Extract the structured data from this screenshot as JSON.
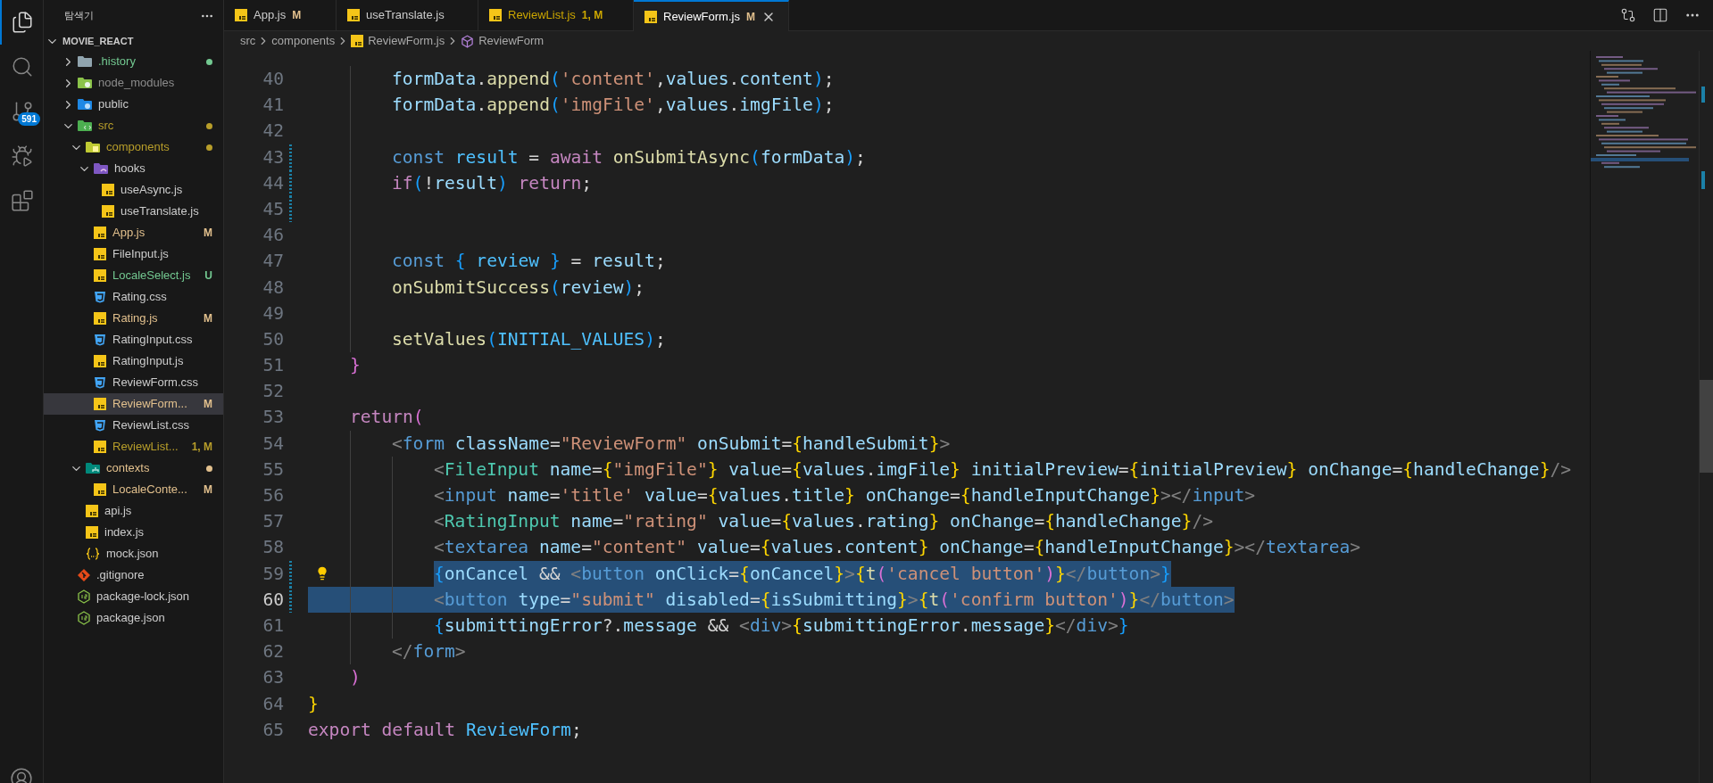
{
  "activity_bar": {
    "items": [
      {
        "kind": "explorer",
        "selected": true
      },
      {
        "kind": "search",
        "selected": false
      },
      {
        "kind": "source-control",
        "selected": false,
        "badge": "591"
      },
      {
        "kind": "run-debug",
        "selected": false
      },
      {
        "kind": "extensions",
        "selected": false
      }
    ]
  },
  "sidebar": {
    "title": "탐색기",
    "root": {
      "name": "MOVIE_REACT",
      "expanded": true,
      "items": [
        {
          "kind": "history-folder",
          "name": ".history",
          "color": "#73c991",
          "dot": true,
          "selected": false,
          "expanded": false
        },
        {
          "kind": "node-folder",
          "name": "node_modules",
          "color": "#8c8c8c",
          "dot": false,
          "selected": false,
          "expanded": false
        },
        {
          "kind": "public-folder",
          "name": "public",
          "color": "#cccccc",
          "dot": false,
          "selected": false,
          "expanded": false
        },
        {
          "kind": "src-folder",
          "name": "src",
          "color": "#b89e2a",
          "dot": true,
          "selected": false,
          "expanded": true,
          "children": [
            {
              "kind": "components-folder",
              "name": "components",
              "color": "#b89e2a",
              "dot": true,
              "selected": false,
              "expanded": true,
              "children": [
                {
                  "kind": "hooks-folder",
                  "name": "hooks",
                  "color": "#cccccc",
                  "dot": false,
                  "selected": false,
                  "expanded": true,
                  "children": [
                    {
                      "kind": "js-file",
                      "name": "useAsync.js",
                      "color": "#cccccc",
                      "dot": false,
                      "selected": false
                    },
                    {
                      "kind": "js-file",
                      "name": "useTranslate.js",
                      "color": "#cccccc",
                      "dot": false,
                      "selected": false
                    }
                  ]
                },
                {
                  "kind": "js-file",
                  "name": "App.js",
                  "color": "#e2c08d",
                  "badge": "M",
                  "dot": false,
                  "selected": false
                },
                {
                  "kind": "js-file",
                  "name": "FileInput.js",
                  "color": "#cccccc",
                  "dot": false,
                  "selected": false
                },
                {
                  "kind": "js-file",
                  "name": "LocaleSelect.js",
                  "color": "#73c991",
                  "badge": "U",
                  "dot": false,
                  "selected": false
                },
                {
                  "kind": "css-file",
                  "name": "Rating.css",
                  "color": "#cccccc",
                  "dot": false,
                  "selected": false
                },
                {
                  "kind": "js-file",
                  "name": "Rating.js",
                  "color": "#e2c08d",
                  "badge": "M",
                  "dot": false,
                  "selected": false
                },
                {
                  "kind": "css-file",
                  "name": "RatingInput.css",
                  "color": "#cccccc",
                  "dot": false,
                  "selected": false
                },
                {
                  "kind": "js-file",
                  "name": "RatingInput.js",
                  "color": "#cccccc",
                  "dot": false,
                  "selected": false
                },
                {
                  "kind": "css-file",
                  "name": "ReviewForm.css",
                  "color": "#cccccc",
                  "dot": false,
                  "selected": false
                },
                {
                  "kind": "js-file",
                  "name": "ReviewForm...",
                  "color": "#e2c08d",
                  "badge": "M",
                  "dot": false,
                  "selected": true
                },
                {
                  "kind": "css-file",
                  "name": "ReviewList.css",
                  "color": "#cccccc",
                  "dot": false,
                  "selected": false
                },
                {
                  "kind": "js-file",
                  "name": "ReviewList...",
                  "color": "#b89e2a",
                  "badge": "1, M",
                  "dot": false,
                  "selected": false
                }
              ]
            },
            {
              "kind": "contexts-folder",
              "name": "contexts",
              "color": "#e2c08d",
              "dot": true,
              "selected": false,
              "expanded": true,
              "children": [
                {
                  "kind": "js-file",
                  "name": "LocaleConte...",
                  "color": "#e2c08d",
                  "badge": "M",
                  "dot": false,
                  "selected": false
                }
              ]
            },
            {
              "kind": "js-file",
              "name": "api.js",
              "color": "#cccccc",
              "dot": false,
              "selected": false
            },
            {
              "kind": "js-file",
              "name": "index.js",
              "color": "#cccccc",
              "dot": false,
              "selected": false
            },
            {
              "kind": "json-file",
              "name": "mock.json",
              "color": "#cccccc",
              "dot": false,
              "selected": false
            }
          ]
        },
        {
          "kind": "git-file",
          "name": ".gitignore",
          "color": "#cccccc",
          "dot": false,
          "selected": false
        },
        {
          "kind": "npm-file",
          "name": "package-lock.json",
          "color": "#cccccc",
          "dot": false,
          "selected": false
        },
        {
          "kind": "npm-file",
          "name": "package.json",
          "color": "#cccccc",
          "dot": false,
          "selected": false
        }
      ]
    }
  },
  "tabs": [
    {
      "label": "App.js",
      "badge": "M",
      "color": "#e2c08d",
      "problems": false,
      "selected": false
    },
    {
      "label": "useTranslate.js",
      "problems": false,
      "selected": false
    },
    {
      "label": "ReviewList.js",
      "badge": "1, M",
      "color": "#cca700",
      "problems": true,
      "selected": false
    },
    {
      "label": "ReviewForm.js",
      "badge": "M",
      "color": "#e2c08d",
      "problems": false,
      "selected": true
    }
  ],
  "breadcrumb": [
    {
      "kind": "folder",
      "text": "src"
    },
    {
      "kind": "folder",
      "text": "components"
    },
    {
      "kind": "js-file",
      "text": "ReviewForm.js"
    },
    {
      "kind": "component",
      "text": "ReviewForm"
    }
  ],
  "lines": [
    {
      "children": [
        {
          "children": [
            {
              "number": "40",
              "selected": false,
              "active": false,
              "modified": false,
              "lightbulb": false,
              "tokens": [
                {
                  "kind": "var",
                  "text": "formData"
                },
                {
                  "kind": "plain",
                  "text": "."
                },
                {
                  "kind": "fn",
                  "text": "append"
                },
                {
                  "kind": "p3",
                  "text": "("
                },
                {
                  "kind": "str",
                  "text": "'content'"
                },
                {
                  "kind": "plain",
                  "text": ","
                },
                {
                  "kind": "var",
                  "text": "values"
                },
                {
                  "kind": "plain",
                  "text": "."
                },
                {
                  "kind": "var",
                  "text": "content"
                },
                {
                  "kind": "p3",
                  "text": ")"
                },
                {
                  "kind": "plain",
                  "text": ";"
                }
              ]
            },
            {
              "number": "41",
              "selected": false,
              "active": false,
              "modified": false,
              "lightbulb": false,
              "tokens": [
                {
                  "kind": "var",
                  "text": "formData"
                },
                {
                  "kind": "plain",
                  "text": "."
                },
                {
                  "kind": "fn",
                  "text": "append"
                },
                {
                  "kind": "p3",
                  "text": "("
                },
                {
                  "kind": "str",
                  "text": "'imgFile'"
                },
                {
                  "kind": "plain",
                  "text": ","
                },
                {
                  "kind": "var",
                  "text": "values"
                },
                {
                  "kind": "plain",
                  "text": "."
                },
                {
                  "kind": "var",
                  "text": "imgFile"
                },
                {
                  "kind": "p3",
                  "text": ")"
                },
                {
                  "kind": "plain",
                  "text": ";"
                }
              ]
            },
            {
              "number": "42",
              "selected": false,
              "active": false,
              "modified": false,
              "lightbulb": false
            },
            {
              "number": "43",
              "selected": false,
              "active": false,
              "modified": true,
              "lightbulb": false,
              "tokens": [
                {
                  "kind": "kw",
                  "text": "const "
                },
                {
                  "kind": "const",
                  "text": "result"
                },
                {
                  "kind": "plain",
                  "text": " = "
                },
                {
                  "kind": "ctrl",
                  "text": "await "
                },
                {
                  "kind": "fn",
                  "text": "onSubmitAsync"
                },
                {
                  "kind": "p3",
                  "text": "("
                },
                {
                  "kind": "var",
                  "text": "formData"
                },
                {
                  "kind": "p3",
                  "text": ")"
                },
                {
                  "kind": "plain",
                  "text": ";"
                }
              ]
            },
            {
              "number": "44",
              "selected": false,
              "active": false,
              "modified": true,
              "lightbulb": false,
              "tokens": [
                {
                  "kind": "ctrl",
                  "text": "if"
                },
                {
                  "kind": "p3",
                  "text": "("
                },
                {
                  "kind": "plain",
                  "text": "!"
                },
                {
                  "kind": "var",
                  "text": "result"
                },
                {
                  "kind": "p3",
                  "text": ")"
                },
                {
                  "kind": "ctrl",
                  "text": " return"
                },
                {
                  "kind": "plain",
                  "text": ";"
                }
              ]
            },
            {
              "number": "45",
              "selected": false,
              "active": false,
              "modified": true,
              "lightbulb": false
            },
            {
              "number": "46",
              "selected": false,
              "active": false,
              "modified": false,
              "lightbulb": false
            },
            {
              "number": "47",
              "selected": false,
              "active": false,
              "modified": false,
              "lightbulb": false,
              "tokens": [
                {
                  "kind": "kw",
                  "text": "const "
                },
                {
                  "kind": "p3",
                  "text": "{"
                },
                {
                  "kind": "const",
                  "text": " review "
                },
                {
                  "kind": "p3",
                  "text": "}"
                },
                {
                  "kind": "plain",
                  "text": " = "
                },
                {
                  "kind": "var",
                  "text": "result"
                },
                {
                  "kind": "plain",
                  "text": ";"
                }
              ]
            },
            {
              "number": "48",
              "selected": false,
              "active": false,
              "modified": false,
              "lightbulb": false,
              "tokens": [
                {
                  "kind": "fn",
                  "text": "onSubmitSuccess"
                },
                {
                  "kind": "p3",
                  "text": "("
                },
                {
                  "kind": "var",
                  "text": "review"
                },
                {
                  "kind": "p3",
                  "text": ")"
                },
                {
                  "kind": "plain",
                  "text": ";"
                }
              ]
            },
            {
              "number": "49",
              "selected": false,
              "active": false,
              "modified": false,
              "lightbulb": false
            },
            {
              "number": "50",
              "selected": false,
              "active": false,
              "modified": false,
              "lightbulb": false,
              "tokens": [
                {
                  "kind": "fn",
                  "text": "setValues"
                },
                {
                  "kind": "p3",
                  "text": "("
                },
                {
                  "kind": "const",
                  "text": "INITIAL_VALUES"
                },
                {
                  "kind": "p3",
                  "text": ")"
                },
                {
                  "kind": "plain",
                  "text": ";"
                }
              ]
            }
          ]
        },
        {
          "number": "51",
          "selected": false,
          "active": false,
          "modified": false,
          "lightbulb": false,
          "tokens": [
            {
              "kind": "p2",
              "text": "}"
            }
          ]
        },
        {
          "number": "52",
          "selected": false,
          "active": false,
          "modified": false,
          "lightbulb": false
        },
        {
          "number": "53",
          "selected": false,
          "active": false,
          "modified": false,
          "lightbulb": false,
          "tokens": [
            {
              "kind": "ctrl",
              "text": "return"
            },
            {
              "kind": "p2",
              "text": "("
            }
          ],
          "children": [
            {
              "number": "54",
              "selected": false,
              "active": false,
              "modified": false,
              "lightbulb": false,
              "tokens": [
                {
                  "kind": "tagp",
                  "text": "<"
                },
                {
                  "kind": "tag",
                  "text": "form "
                },
                {
                  "kind": "attr",
                  "text": "className"
                },
                {
                  "kind": "plain",
                  "text": "="
                },
                {
                  "kind": "str",
                  "text": "\"ReviewForm\" "
                },
                {
                  "kind": "attr",
                  "text": "onSubmit"
                },
                {
                  "kind": "plain",
                  "text": "="
                },
                {
                  "kind": "p1",
                  "text": "{"
                },
                {
                  "kind": "var",
                  "text": "handleSubmit"
                },
                {
                  "kind": "p1",
                  "text": "}"
                },
                {
                  "kind": "tagp",
                  "text": ">"
                }
              ],
              "children": [
                {
                  "number": "55",
                  "selected": false,
                  "active": false,
                  "modified": false,
                  "lightbulb": false,
                  "tokens": [
                    {
                      "kind": "tagp",
                      "text": "<"
                    },
                    {
                      "kind": "comp",
                      "text": "FileInput "
                    },
                    {
                      "kind": "attr",
                      "text": "name"
                    },
                    {
                      "kind": "plain",
                      "text": "="
                    },
                    {
                      "kind": "p1",
                      "text": "{"
                    },
                    {
                      "kind": "str",
                      "text": "\"imgFile\""
                    },
                    {
                      "kind": "p1",
                      "text": "} "
                    },
                    {
                      "kind": "attr",
                      "text": "value"
                    },
                    {
                      "kind": "plain",
                      "text": "="
                    },
                    {
                      "kind": "p1",
                      "text": "{"
                    },
                    {
                      "kind": "var",
                      "text": "values"
                    },
                    {
                      "kind": "plain",
                      "text": "."
                    },
                    {
                      "kind": "var",
                      "text": "imgFile"
                    },
                    {
                      "kind": "p1",
                      "text": "} "
                    },
                    {
                      "kind": "attr",
                      "text": "initialPreview"
                    },
                    {
                      "kind": "plain",
                      "text": "="
                    },
                    {
                      "kind": "p1",
                      "text": "{"
                    },
                    {
                      "kind": "var",
                      "text": "initialPreview"
                    },
                    {
                      "kind": "p1",
                      "text": "} "
                    },
                    {
                      "kind": "attr",
                      "text": "onChange"
                    },
                    {
                      "kind": "plain",
                      "text": "="
                    },
                    {
                      "kind": "p1",
                      "text": "{"
                    },
                    {
                      "kind": "var",
                      "text": "handleChange"
                    },
                    {
                      "kind": "p1",
                      "text": "}"
                    },
                    {
                      "kind": "tagp",
                      "text": "/>"
                    }
                  ]
                },
                {
                  "number": "56",
                  "selected": false,
                  "active": false,
                  "modified": false,
                  "lightbulb": false,
                  "tokens": [
                    {
                      "kind": "tagp",
                      "text": "<"
                    },
                    {
                      "kind": "tag",
                      "text": "input "
                    },
                    {
                      "kind": "attr",
                      "text": "name"
                    },
                    {
                      "kind": "plain",
                      "text": "="
                    },
                    {
                      "kind": "str",
                      "text": "'title' "
                    },
                    {
                      "kind": "attr",
                      "text": "value"
                    },
                    {
                      "kind": "plain",
                      "text": "="
                    },
                    {
                      "kind": "p1",
                      "text": "{"
                    },
                    {
                      "kind": "var",
                      "text": "values"
                    },
                    {
                      "kind": "plain",
                      "text": "."
                    },
                    {
                      "kind": "var",
                      "text": "title"
                    },
                    {
                      "kind": "p1",
                      "text": "} "
                    },
                    {
                      "kind": "attr",
                      "text": "onChange"
                    },
                    {
                      "kind": "plain",
                      "text": "="
                    },
                    {
                      "kind": "p1",
                      "text": "{"
                    },
                    {
                      "kind": "var",
                      "text": "handleInputChange"
                    },
                    {
                      "kind": "p1",
                      "text": "}"
                    },
                    {
                      "kind": "tagp",
                      "text": "></"
                    },
                    {
                      "kind": "tag",
                      "text": "input"
                    },
                    {
                      "kind": "tagp",
                      "text": ">"
                    }
                  ]
                },
                {
                  "number": "57",
                  "selected": false,
                  "active": false,
                  "modified": false,
                  "lightbulb": false,
                  "tokens": [
                    {
                      "kind": "tagp",
                      "text": "<"
                    },
                    {
                      "kind": "comp",
                      "text": "RatingInput "
                    },
                    {
                      "kind": "attr",
                      "text": "name"
                    },
                    {
                      "kind": "plain",
                      "text": "="
                    },
                    {
                      "kind": "str",
                      "text": "\"rating\" "
                    },
                    {
                      "kind": "attr",
                      "text": "value"
                    },
                    {
                      "kind": "plain",
                      "text": "="
                    },
                    {
                      "kind": "p1",
                      "text": "{"
                    },
                    {
                      "kind": "var",
                      "text": "values"
                    },
                    {
                      "kind": "plain",
                      "text": "."
                    },
                    {
                      "kind": "var",
                      "text": "rating"
                    },
                    {
                      "kind": "p1",
                      "text": "} "
                    },
                    {
                      "kind": "attr",
                      "text": "onChange"
                    },
                    {
                      "kind": "plain",
                      "text": "="
                    },
                    {
                      "kind": "p1",
                      "text": "{"
                    },
                    {
                      "kind": "var",
                      "text": "handleChange"
                    },
                    {
                      "kind": "p1",
                      "text": "}"
                    },
                    {
                      "kind": "tagp",
                      "text": "/>"
                    }
                  ]
                },
                {
                  "number": "58",
                  "selected": false,
                  "active": false,
                  "modified": false,
                  "lightbulb": false,
                  "tokens": [
                    {
                      "kind": "tagp",
                      "text": "<"
                    },
                    {
                      "kind": "tag",
                      "text": "textarea "
                    },
                    {
                      "kind": "attr",
                      "text": "name"
                    },
                    {
                      "kind": "plain",
                      "text": "="
                    },
                    {
                      "kind": "str",
                      "text": "\"content\" "
                    },
                    {
                      "kind": "attr",
                      "text": "value"
                    },
                    {
                      "kind": "plain",
                      "text": "="
                    },
                    {
                      "kind": "p1",
                      "text": "{"
                    },
                    {
                      "kind": "var",
                      "text": "values"
                    },
                    {
                      "kind": "plain",
                      "text": "."
                    },
                    {
                      "kind": "var",
                      "text": "content"
                    },
                    {
                      "kind": "p1",
                      "text": "} "
                    },
                    {
                      "kind": "attr",
                      "text": "onChange"
                    },
                    {
                      "kind": "plain",
                      "text": "="
                    },
                    {
                      "kind": "p1",
                      "text": "{"
                    },
                    {
                      "kind": "var",
                      "text": "handleInputChange"
                    },
                    {
                      "kind": "p1",
                      "text": "}"
                    },
                    {
                      "kind": "tagp",
                      "text": "></"
                    },
                    {
                      "kind": "tag",
                      "text": "textarea"
                    },
                    {
                      "kind": "tagp",
                      "text": ">"
                    }
                  ]
                },
                {
                  "number": "59",
                  "selected": true,
                  "active": false,
                  "modified": true,
                  "lightbulb": true,
                  "tokens": [
                    {
                      "kind": "p3",
                      "text": "{"
                    },
                    {
                      "kind": "var",
                      "text": "onCancel "
                    },
                    {
                      "kind": "plain",
                      "text": "&& "
                    },
                    {
                      "kind": "tagp",
                      "text": "<"
                    },
                    {
                      "kind": "tag",
                      "text": "button "
                    },
                    {
                      "kind": "attr",
                      "text": "onClick"
                    },
                    {
                      "kind": "plain",
                      "text": "="
                    },
                    {
                      "kind": "p1",
                      "text": "{"
                    },
                    {
                      "kind": "var",
                      "text": "onCancel"
                    },
                    {
                      "kind": "p1",
                      "text": "}"
                    },
                    {
                      "kind": "tagp",
                      "text": ">"
                    },
                    {
                      "kind": "p1",
                      "text": "{"
                    },
                    {
                      "kind": "fn",
                      "text": "t"
                    },
                    {
                      "kind": "p2",
                      "text": "("
                    },
                    {
                      "kind": "str",
                      "text": "'cancel button'"
                    },
                    {
                      "kind": "p2",
                      "text": ")"
                    },
                    {
                      "kind": "p1",
                      "text": "}"
                    },
                    {
                      "kind": "tagp",
                      "text": "</"
                    },
                    {
                      "kind": "tag",
                      "text": "button"
                    },
                    {
                      "kind": "tagp",
                      "text": ">"
                    },
                    {
                      "kind": "p3",
                      "text": "}"
                    }
                  ]
                },
                {
                  "number": "60",
                  "selected": true,
                  "active": true,
                  "modified": true,
                  "lightbulb": false,
                  "tokens": [
                    {
                      "kind": "tagp",
                      "text": "<"
                    },
                    {
                      "kind": "tag",
                      "text": "button "
                    },
                    {
                      "kind": "attr",
                      "text": "type"
                    },
                    {
                      "kind": "plain",
                      "text": "="
                    },
                    {
                      "kind": "str",
                      "text": "\"submit\" "
                    },
                    {
                      "kind": "attr",
                      "text": "disabled"
                    },
                    {
                      "kind": "plain",
                      "text": "="
                    },
                    {
                      "kind": "p1",
                      "text": "{"
                    },
                    {
                      "kind": "var",
                      "text": "isSubmitting"
                    },
                    {
                      "kind": "p1",
                      "text": "}"
                    },
                    {
                      "kind": "tagp",
                      "text": ">"
                    },
                    {
                      "kind": "p1",
                      "text": "{"
                    },
                    {
                      "kind": "fn",
                      "text": "t"
                    },
                    {
                      "kind": "p2",
                      "text": "("
                    },
                    {
                      "kind": "str",
                      "text": "'confirm button'"
                    },
                    {
                      "kind": "p2",
                      "text": ")"
                    },
                    {
                      "kind": "p1",
                      "text": "}"
                    },
                    {
                      "kind": "tagp",
                      "text": "</"
                    },
                    {
                      "kind": "tag",
                      "text": "button"
                    },
                    {
                      "kind": "tagp",
                      "text": ">"
                    }
                  ]
                },
                {
                  "number": "61",
                  "selected": false,
                  "active": false,
                  "modified": false,
                  "lightbulb": false,
                  "tokens": [
                    {
                      "kind": "p3",
                      "text": "{"
                    },
                    {
                      "kind": "var",
                      "text": "submittingError"
                    },
                    {
                      "kind": "plain",
                      "text": "?."
                    },
                    {
                      "kind": "var",
                      "text": "message "
                    },
                    {
                      "kind": "plain",
                      "text": "&& "
                    },
                    {
                      "kind": "tagp",
                      "text": "<"
                    },
                    {
                      "kind": "tag",
                      "text": "div"
                    },
                    {
                      "kind": "tagp",
                      "text": ">"
                    },
                    {
                      "kind": "p1",
                      "text": "{"
                    },
                    {
                      "kind": "var",
                      "text": "submittingError"
                    },
                    {
                      "kind": "plain",
                      "text": "."
                    },
                    {
                      "kind": "var",
                      "text": "message"
                    },
                    {
                      "kind": "p1",
                      "text": "}"
                    },
                    {
                      "kind": "tagp",
                      "text": "</"
                    },
                    {
                      "kind": "tag",
                      "text": "div"
                    },
                    {
                      "kind": "tagp",
                      "text": ">"
                    },
                    {
                      "kind": "p3",
                      "text": "}"
                    }
                  ]
                }
              ]
            },
            {
              "number": "62",
              "selected": false,
              "active": false,
              "modified": false,
              "lightbulb": false,
              "tokens": [
                {
                  "kind": "tagp",
                  "text": "</"
                },
                {
                  "kind": "tag",
                  "text": "form"
                },
                {
                  "kind": "tagp",
                  "text": ">"
                }
              ]
            }
          ]
        },
        {
          "number": "63",
          "selected": false,
          "active": false,
          "modified": false,
          "lightbulb": false,
          "tokens": [
            {
              "kind": "p2",
              "text": ")"
            }
          ]
        }
      ]
    },
    {
      "number": "64",
      "selected": false,
      "active": false,
      "modified": false,
      "lightbulb": false,
      "tokens": [
        {
          "kind": "p1",
          "text": "}"
        }
      ]
    },
    {
      "number": "65",
      "selected": false,
      "active": false,
      "modified": false,
      "lightbulb": false,
      "tokens": [
        {
          "kind": "ctrl",
          "text": "export default "
        },
        {
          "kind": "const",
          "text": "ReviewForm"
        },
        {
          "kind": "plain",
          "text": ";"
        }
      ]
    }
  ]
}
